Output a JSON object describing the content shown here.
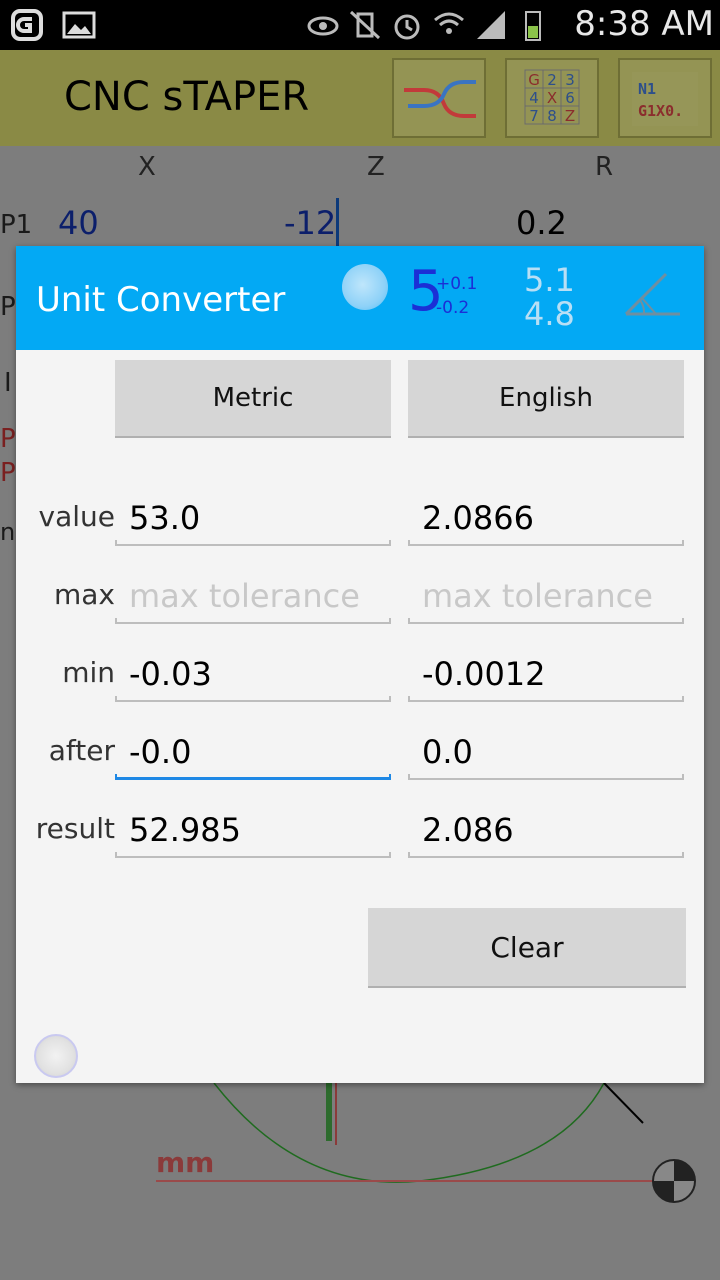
{
  "status_bar": {
    "time": "8:38 AM"
  },
  "app": {
    "title": "CNC sTAPER",
    "toolbar": {
      "grid_digits": [
        "G",
        "2",
        "3",
        "4",
        "X",
        "6",
        "7",
        "8",
        "Z"
      ],
      "code_line1": "N1",
      "code_line2": "G1X0."
    }
  },
  "background": {
    "columns": [
      "X",
      "Z",
      "R"
    ],
    "p1": {
      "label": "P1",
      "x": "40",
      "z": "-12",
      "r": "0.2"
    },
    "bottom_label": "mm"
  },
  "dialog": {
    "title": "Unit Converter",
    "tolerance_icon": {
      "base": "5",
      "upper": "+0.1",
      "lower": "-0.2"
    },
    "range_icon": {
      "top": "5.1",
      "bottom": "4.8"
    },
    "tabs": {
      "metric": "Metric",
      "english": "English"
    },
    "rows": [
      {
        "label": "value",
        "metric": "53.0",
        "english": "2.0866",
        "placeholder": ""
      },
      {
        "label": "max",
        "metric": "",
        "english": "",
        "placeholder": "max tolerance"
      },
      {
        "label": "min",
        "metric": "-0.03",
        "english": "-0.0012",
        "placeholder": ""
      },
      {
        "label": "after",
        "metric": "-0.0",
        "english": "0.0",
        "placeholder": ""
      },
      {
        "label": "result",
        "metric": "52.985",
        "english": "2.086",
        "placeholder": ""
      }
    ],
    "clear_label": "Clear"
  },
  "colors": {
    "dialog_header": "#03a9f4",
    "dim_overlay_appbar": "#8a8a45",
    "focus_underline": "#1e88e5"
  }
}
